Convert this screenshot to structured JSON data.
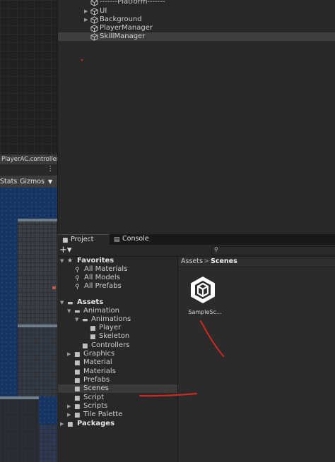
{
  "animator": {
    "controller_label": "PlayerAC.controller",
    "more_icon": "kebab-menu-icon"
  },
  "game_toolbar": {
    "stats_label": "Stats",
    "gizmos_label": "Gizmos",
    "gizmos_caret_icon": "caret-down-icon"
  },
  "hierarchy": {
    "items": [
      {
        "label": "-------Platform-------",
        "arrow": ""
      },
      {
        "label": "UI",
        "arrow": "▶"
      },
      {
        "label": "Background",
        "arrow": "▶"
      },
      {
        "label": "PlayerManager",
        "arrow": ""
      },
      {
        "label": "SkillManager",
        "arrow": ""
      }
    ]
  },
  "tabs": {
    "project": "Project",
    "console": "Console"
  },
  "toolbar": {
    "add_label": "+▾",
    "search_icon": "search-icon"
  },
  "tree": {
    "favorites": "Favorites",
    "all_materials": "All Materials",
    "all_models": "All Models",
    "all_prefabs": "All Prefabs",
    "assets": "Assets",
    "animation": "Animation",
    "animations": "Animations",
    "player": "Player",
    "skeleton": "Skeleton",
    "controllers": "Controllers",
    "graphics": "Graphics",
    "material": "Material",
    "materials": "Materials",
    "prefabs": "Prefabs",
    "scenes": "Scenes",
    "script": "Script",
    "scripts": "Scripts",
    "tile_palette": "Tile Palette",
    "packages": "Packages"
  },
  "breadcrumb": {
    "root": "Assets",
    "separator": ">",
    "current": "Scenes"
  },
  "assets_grid": {
    "items": [
      {
        "label": "SampleSc...",
        "icon": "unity-scene-icon"
      }
    ]
  },
  "colors": {
    "panel_bg": "#282828",
    "selection": "#3e3e3e",
    "annotation_red": "#d0281f",
    "game_bg": "#173560"
  }
}
